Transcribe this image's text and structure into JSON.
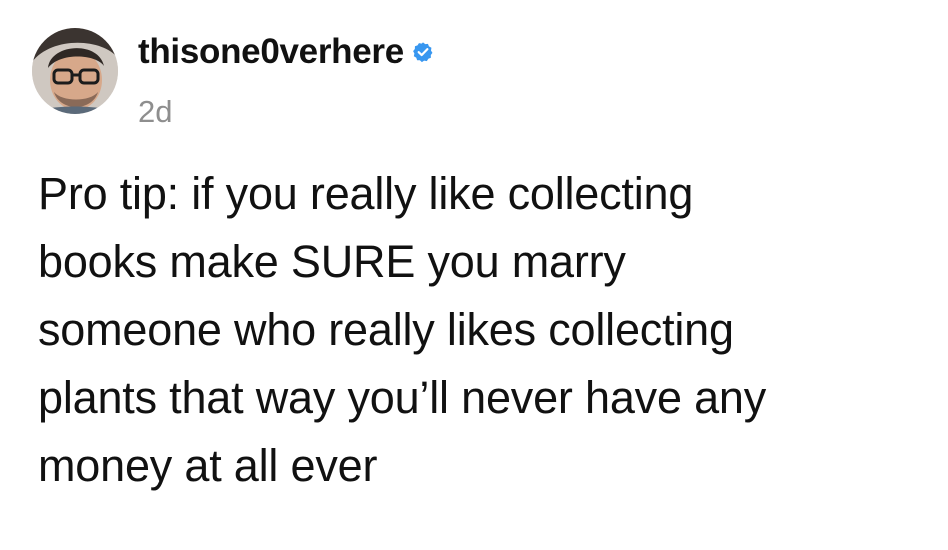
{
  "post": {
    "username": "thisone0verhere",
    "verified": true,
    "verified_icon": "verified-badge-icon",
    "timestamp": "2d",
    "text_lines": [
      "Pro tip: if you really like collecting",
      "books make SURE you marry",
      "someone who really likes collecting",
      "plants that way you’ll never have any",
      "money at all ever"
    ]
  },
  "colors": {
    "background": "#ffffff",
    "text": "#111111",
    "timestamp": "#8e8e8e",
    "verified_badge": "#3897f0"
  }
}
